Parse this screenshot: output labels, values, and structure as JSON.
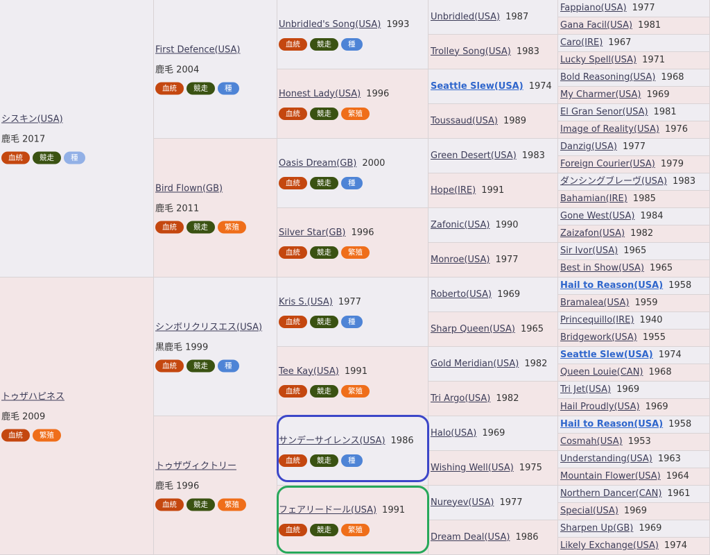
{
  "badge_labels": {
    "blood": "血統",
    "race": "競走",
    "stud": "種",
    "breed": "繁殖"
  },
  "gen1": [
    {
      "name": "シスキン(USA)",
      "coat": "鹿毛 2017",
      "badges": [
        "blood",
        "race",
        "stud-light"
      ]
    },
    {
      "name": "トゥザハピネス",
      "coat": "鹿毛 2009",
      "badges": [
        "blood",
        "breed"
      ]
    }
  ],
  "gen2": [
    {
      "name": "First Defence(USA)",
      "coat": "鹿毛 2004",
      "badges": [
        "blood",
        "race",
        "stud"
      ]
    },
    {
      "name": "Bird Flown(GB)",
      "coat": "鹿毛 2011",
      "badges": [
        "blood",
        "race",
        "breed"
      ]
    },
    {
      "name": "シンボリクリスエス(USA)",
      "coat": "黒鹿毛 1999",
      "badges": [
        "blood",
        "race",
        "stud"
      ]
    },
    {
      "name": "トゥザヴィクトリー",
      "coat": "鹿毛 1996",
      "badges": [
        "blood",
        "race",
        "breed"
      ]
    }
  ],
  "gen3": [
    {
      "name": "Unbridled's Song(USA)",
      "year": "1993",
      "badges": [
        "blood",
        "race",
        "stud"
      ]
    },
    {
      "name": "Honest Lady(USA)",
      "year": "1996",
      "badges": [
        "blood",
        "race",
        "breed"
      ]
    },
    {
      "name": "Oasis Dream(GB)",
      "year": "2000",
      "badges": [
        "blood",
        "race",
        "stud"
      ]
    },
    {
      "name": "Silver Star(GB)",
      "year": "1996",
      "badges": [
        "blood",
        "race",
        "breed"
      ]
    },
    {
      "name": "Kris S.(USA)",
      "year": "1977",
      "badges": [
        "blood",
        "race",
        "stud"
      ]
    },
    {
      "name": "Tee Kay(USA)",
      "year": "1991",
      "badges": [
        "blood",
        "race",
        "breed"
      ]
    },
    {
      "name": "サンデーサイレンス(USA)",
      "year": "1986",
      "badges": [
        "blood",
        "race",
        "stud"
      ]
    },
    {
      "name": "フェアリードール(USA)",
      "year": "1991",
      "badges": [
        "blood",
        "race",
        "breed"
      ]
    }
  ],
  "gen4": [
    {
      "name": "Unbridled(USA)",
      "year": "1987"
    },
    {
      "name": "Trolley Song(USA)",
      "year": "1983"
    },
    {
      "name": "Seattle Slew(USA)",
      "year": "1974",
      "highlight": true
    },
    {
      "name": "Toussaud(USA)",
      "year": "1989"
    },
    {
      "name": "Green Desert(USA)",
      "year": "1983"
    },
    {
      "name": "Hope(IRE)",
      "year": "1991"
    },
    {
      "name": "Zafonic(USA)",
      "year": "1990"
    },
    {
      "name": "Monroe(USA)",
      "year": "1977"
    },
    {
      "name": "Roberto(USA)",
      "year": "1969"
    },
    {
      "name": "Sharp Queen(USA)",
      "year": "1965"
    },
    {
      "name": "Gold Meridian(USA)",
      "year": "1982"
    },
    {
      "name": "Tri Argo(USA)",
      "year": "1982"
    },
    {
      "name": "Halo(USA)",
      "year": "1969"
    },
    {
      "name": "Wishing Well(USA)",
      "year": "1975"
    },
    {
      "name": "Nureyev(USA)",
      "year": "1977"
    },
    {
      "name": "Dream Deal(USA)",
      "year": "1986"
    }
  ],
  "gen5": [
    {
      "name": "Fappiano(USA)",
      "year": "1977"
    },
    {
      "name": "Gana Facil(USA)",
      "year": "1981"
    },
    {
      "name": "Caro(IRE)",
      "year": "1967"
    },
    {
      "name": "Lucky Spell(USA)",
      "year": "1971"
    },
    {
      "name": "Bold Reasoning(USA)",
      "year": "1968"
    },
    {
      "name": "My Charmer(USA)",
      "year": "1969"
    },
    {
      "name": "El Gran Senor(USA)",
      "year": "1981"
    },
    {
      "name": "Image of Reality(USA)",
      "year": "1976"
    },
    {
      "name": "Danzig(USA)",
      "year": "1977"
    },
    {
      "name": "Foreign Courier(USA)",
      "year": "1979"
    },
    {
      "name": "ダンシングブレーヴ(USA)",
      "year": "1983"
    },
    {
      "name": "Bahamian(IRE)",
      "year": "1985"
    },
    {
      "name": "Gone West(USA)",
      "year": "1984"
    },
    {
      "name": "Zaizafon(USA)",
      "year": "1982"
    },
    {
      "name": "Sir Ivor(USA)",
      "year": "1965"
    },
    {
      "name": "Best in Show(USA)",
      "year": "1965"
    },
    {
      "name": "Hail to Reason(USA)",
      "year": "1958",
      "highlight": true
    },
    {
      "name": "Bramalea(USA)",
      "year": "1959"
    },
    {
      "name": "Princequillo(IRE)",
      "year": "1940"
    },
    {
      "name": "Bridgework(USA)",
      "year": "1955"
    },
    {
      "name": "Seattle Slew(USA)",
      "year": "1974",
      "highlight": true
    },
    {
      "name": "Queen Louie(CAN)",
      "year": "1968"
    },
    {
      "name": "Tri Jet(USA)",
      "year": "1969"
    },
    {
      "name": "Hail Proudly(USA)",
      "year": "1969"
    },
    {
      "name": "Hail to Reason(USA)",
      "year": "1958",
      "highlight": true
    },
    {
      "name": "Cosmah(USA)",
      "year": "1953"
    },
    {
      "name": "Understanding(USA)",
      "year": "1963"
    },
    {
      "name": "Mountain Flower(USA)",
      "year": "1964"
    },
    {
      "name": "Northern Dancer(CAN)",
      "year": "1961"
    },
    {
      "name": "Special(USA)",
      "year": "1969"
    },
    {
      "name": "Sharpen Up(GB)",
      "year": "1969"
    },
    {
      "name": "Likely Exchange(USA)",
      "year": "1974"
    }
  ]
}
